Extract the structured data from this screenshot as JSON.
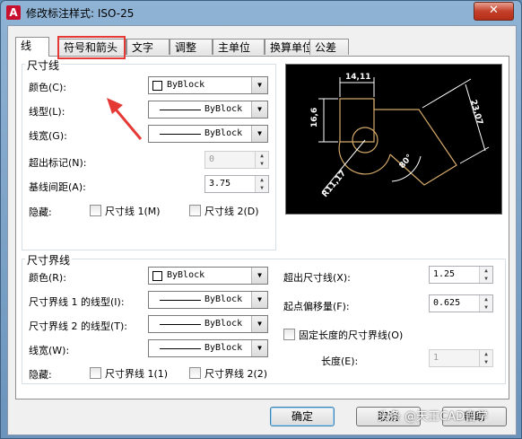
{
  "window": {
    "title": "修改标注样式: ISO-25",
    "close": "✕"
  },
  "tabs": [
    "线",
    "符号和箭头",
    "文字",
    "调整",
    "主单位",
    "换算单位",
    "公差"
  ],
  "dimline": {
    "group": "尺寸线",
    "color_label": "颜色(C):",
    "color_value": "ByBlock",
    "linetype_label": "线型(L):",
    "linetype_value": "ByBlock",
    "lineweight_label": "线宽(G):",
    "lineweight_value": "ByBlock",
    "extend_label": "超出标记(N):",
    "extend_value": "0",
    "baseline_label": "基线间距(A):",
    "baseline_value": "3.75",
    "suppress_label": "隐藏:",
    "suppress1": "尺寸线 1(M)",
    "suppress2": "尺寸线 2(D)"
  },
  "extline": {
    "group": "尺寸界线",
    "color_label": "颜色(R):",
    "color_value": "ByBlock",
    "lt1_label": "尺寸界线 1 的线型(I):",
    "lt1_value": "ByBlock",
    "lt2_label": "尺寸界线 2 的线型(T):",
    "lt2_value": "ByBlock",
    "lw_label": "线宽(W):",
    "lw_value": "ByBlock",
    "suppress_label": "隐藏:",
    "suppress1": "尺寸界线 1(1)",
    "suppress2": "尺寸界线 2(2)",
    "beyond_label": "超出尺寸线(X):",
    "beyond_value": "1.25",
    "offset_label": "起点偏移量(F):",
    "offset_value": "0.625",
    "fixed_label": "固定长度的尺寸界线(O)",
    "length_label": "长度(E):",
    "length_value": "1"
  },
  "preview": {
    "dim_top": "14,11",
    "dim_left": "16,6",
    "dim_right": "23,07",
    "angle": "80°",
    "radius": "R11,17"
  },
  "buttons": {
    "ok": "确定",
    "cancel": "取消",
    "help": "帮助"
  },
  "watermark": "头条 @天正CAD自学",
  "colors": {
    "highlight": "#e53935",
    "preview_bg": "#000000",
    "preview_line": "#ffffff",
    "preview_shape": "#d4a96a"
  }
}
